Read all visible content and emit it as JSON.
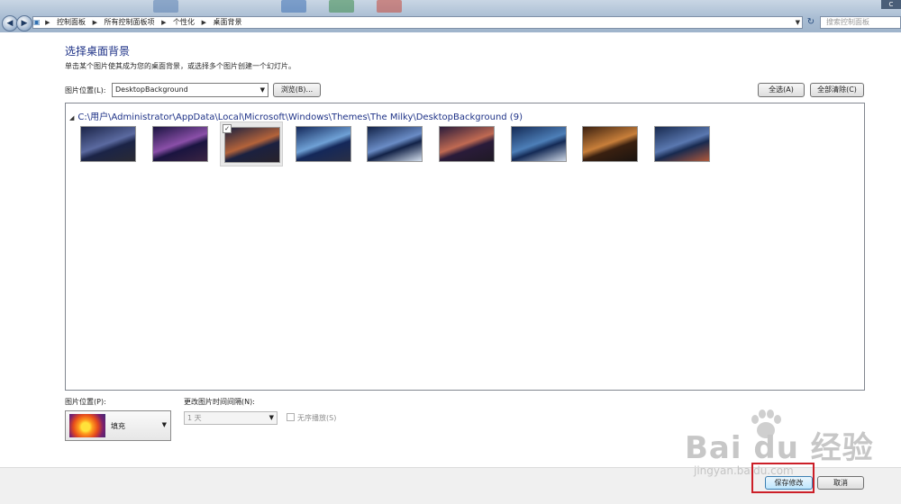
{
  "address_bar": {
    "breadcrumbs": [
      "控制面板",
      "所有控制面板项",
      "个性化",
      "桌面背景"
    ],
    "search_placeholder": "搜索控制面板"
  },
  "window_close_glyph": "C",
  "heading": "选择桌面背景",
  "subtitle": "单击某个图片使其成为您的桌面背景，或选择多个图片创建一个幻灯片。",
  "location": {
    "label": "图片位置(L):",
    "value": "DesktopBackground",
    "browse_label": "浏览(B)..."
  },
  "select_all_label": "全选(A)",
  "clear_all_label": "全部清除(C)",
  "gallery": {
    "group_title": "C:\\用户\\Administrator\\AppData\\Local\\Microsoft\\Windows\\Themes\\The Milky\\DesktopBackground (9)",
    "selected_index": 2,
    "thumbnails": [
      {
        "name": "milky-way-1",
        "colors": [
          "#1b2447",
          "#5b6aa0",
          "#2a2a33"
        ]
      },
      {
        "name": "milky-way-2",
        "colors": [
          "#1a1440",
          "#8a4fa8",
          "#3b2442"
        ]
      },
      {
        "name": "milky-way-3",
        "colors": [
          "#1b2140",
          "#b4633a",
          "#28222a"
        ]
      },
      {
        "name": "milky-way-4",
        "colors": [
          "#14285a",
          "#6fa1d6",
          "#2a2f45"
        ]
      },
      {
        "name": "milky-way-5",
        "colors": [
          "#122247",
          "#6a8cc6",
          "#d7e2f0"
        ]
      },
      {
        "name": "milky-way-6",
        "colors": [
          "#2a1b3a",
          "#c06a52",
          "#1f1a24"
        ]
      },
      {
        "name": "milky-way-7",
        "colors": [
          "#142a55",
          "#4d7fb8",
          "#cfd8e6"
        ]
      },
      {
        "name": "milky-way-8",
        "colors": [
          "#3a2010",
          "#c87f3a",
          "#1a1410"
        ]
      },
      {
        "name": "milky-way-9",
        "colors": [
          "#182a4f",
          "#5a78b0",
          "#b0583a"
        ]
      }
    ]
  },
  "position": {
    "label": "图片位置(P):",
    "value": "填充"
  },
  "interval": {
    "label": "更改图片时间间隔(N):",
    "value": "1 天"
  },
  "shuffle_label": "无序播放(S)",
  "save_label": "保存修改",
  "cancel_label": "取消",
  "watermark": {
    "logo": "Bai du 经验",
    "url": "jingyan.baidu.com"
  },
  "colors": {
    "highlight": "#cc1f28",
    "heading": "#1e3287"
  }
}
